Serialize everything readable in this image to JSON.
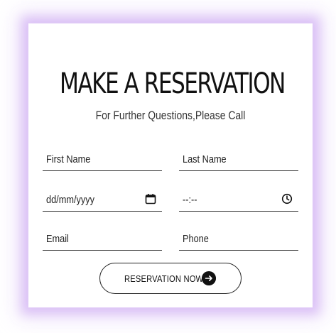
{
  "form": {
    "title": "MAKE A RESERVATION",
    "subtitle": "For Further Questions,Please Call",
    "fields": {
      "first_name": {
        "placeholder": "First Name",
        "icon": null
      },
      "last_name": {
        "placeholder": "Last Name",
        "icon": null
      },
      "date": {
        "placeholder": "dd/mm/yyyy",
        "icon": "calendar-icon"
      },
      "time": {
        "placeholder": "--:--",
        "icon": "clock-icon"
      },
      "email": {
        "placeholder": "Email",
        "icon": null
      },
      "phone": {
        "placeholder": "Phone",
        "icon": null
      }
    },
    "submit": {
      "label": "RESERVATION NOW",
      "icon": "arrow-right-circle-icon"
    }
  },
  "colors": {
    "text": "#111111",
    "border": "#333333",
    "glow": "#c8a0f0",
    "background": "#ffffff"
  }
}
